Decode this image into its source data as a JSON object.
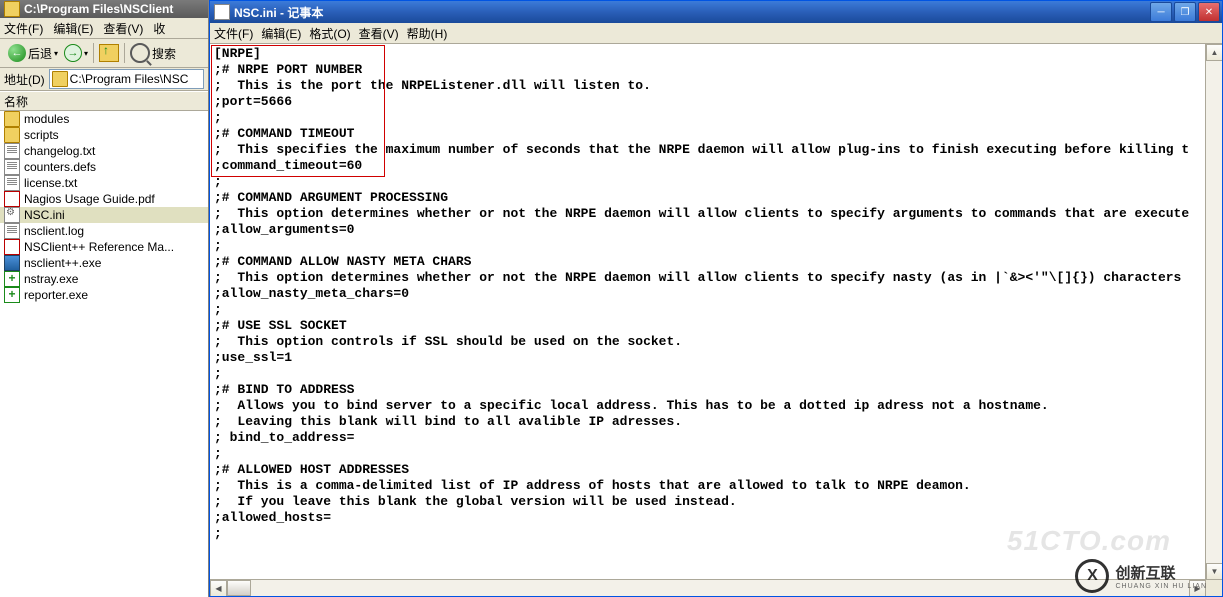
{
  "explorer": {
    "title": "C:\\Program Files\\NSClient",
    "menu": [
      "文件(F)",
      "编辑(E)",
      "查看(V)",
      "收"
    ],
    "back": "后退",
    "search": "搜索",
    "addr_label": "地址(D)",
    "addr_path": "C:\\Program Files\\NSC",
    "col_name": "名称",
    "files": [
      {
        "icon": "fld",
        "name": "modules"
      },
      {
        "icon": "fld",
        "name": "scripts"
      },
      {
        "icon": "txt",
        "name": "changelog.txt"
      },
      {
        "icon": "txt",
        "name": "counters.defs"
      },
      {
        "icon": "txt",
        "name": "license.txt"
      },
      {
        "icon": "pdf",
        "name": "Nagios Usage Guide.pdf"
      },
      {
        "icon": "ini",
        "name": "NSC.ini",
        "sel": true
      },
      {
        "icon": "txt",
        "name": "nsclient.log"
      },
      {
        "icon": "pdf",
        "name": "NSClient++ Reference Ma..."
      },
      {
        "icon": "exe",
        "name": "nsclient++.exe"
      },
      {
        "icon": "greenplus",
        "name": "nstray.exe"
      },
      {
        "icon": "greenplus",
        "name": "reporter.exe"
      }
    ]
  },
  "notepad": {
    "title": "NSC.ini - 记事本",
    "menu": [
      "文件(F)",
      "编辑(E)",
      "格式(O)",
      "查看(V)",
      "帮助(H)"
    ],
    "content": "[NRPE]\n;# NRPE PORT NUMBER\n;  This is the port the NRPEListener.dll will listen to.\n;port=5666\n;\n;# COMMAND TIMEOUT\n;  This specifies the maximum number of seconds that the NRPE daemon will allow plug-ins to finish executing before killing t\n;command_timeout=60\n;\n;# COMMAND ARGUMENT PROCESSING\n;  This option determines whether or not the NRPE daemon will allow clients to specify arguments to commands that are execute\n;allow_arguments=0\n;\n;# COMMAND ALLOW NASTY META CHARS\n;  This option determines whether or not the NRPE daemon will allow clients to specify nasty (as in |`&><'\"\\[]{}) characters \n;allow_nasty_meta_chars=0\n;\n;# USE SSL SOCKET\n;  This option controls if SSL should be used on the socket.\n;use_ssl=1\n;\n;# BIND TO ADDRESS\n;  Allows you to bind server to a specific local address. This has to be a dotted ip adress not a hostname.\n;  Leaving this blank will bind to all avalible IP adresses.\n; bind_to_address=\n;\n;# ALLOWED HOST ADDRESSES\n;  This is a comma-delimited list of IP address of hosts that are allowed to talk to NRPE deamon.\n;  If you leave this blank the global version will be used instead.\n;allowed_hosts=\n;"
  },
  "watermark1": "51CTO.com",
  "watermark2": {
    "zh": "创新互联",
    "py": "CHUANG XIN HU LIAN"
  }
}
